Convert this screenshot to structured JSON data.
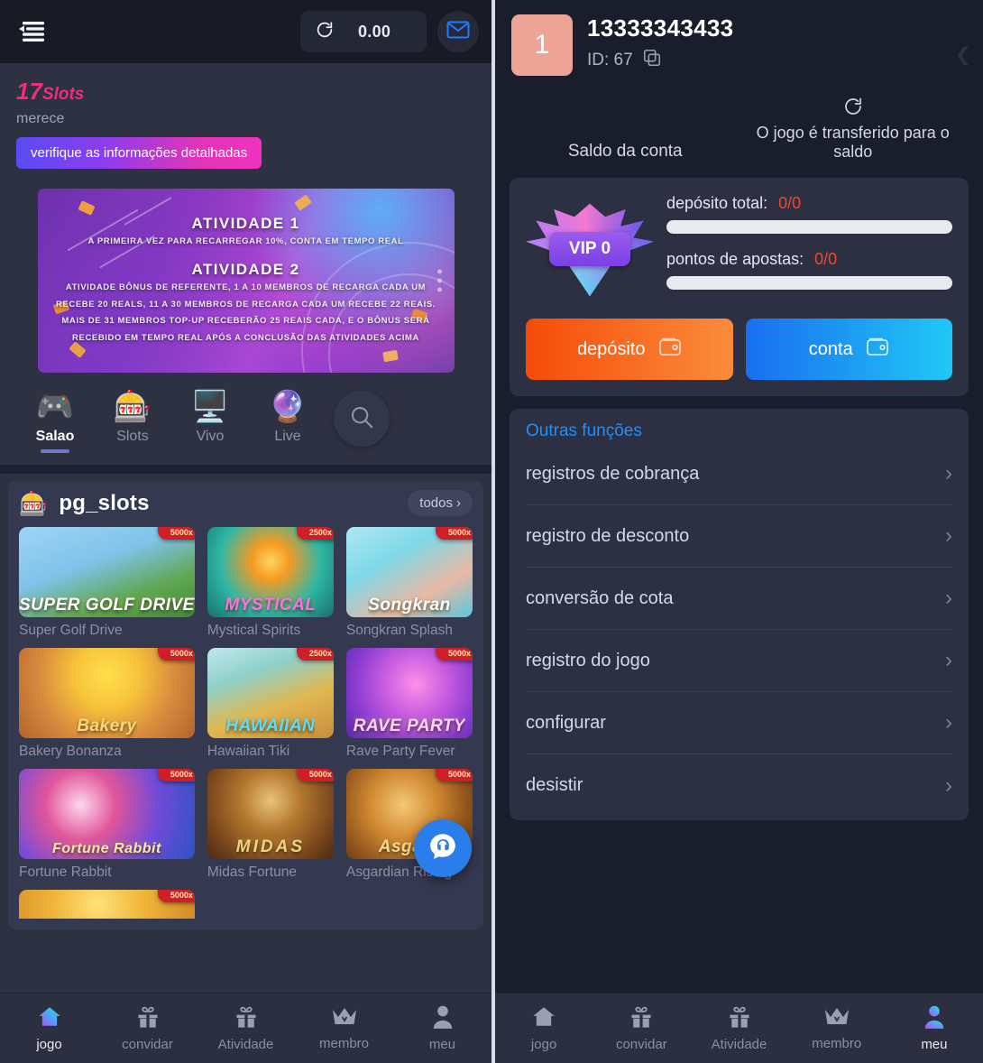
{
  "left": {
    "topbar": {
      "menu_icon": "hamburger-menu-icon",
      "refresh_icon": "refresh-icon",
      "balance": "0.00",
      "mail_icon": "envelope-icon"
    },
    "promo": {
      "brand_number": "17",
      "brand_word": "Slots",
      "subtitle": "merece",
      "button": "verifique as informações detalhadas"
    },
    "banner": {
      "heading1": "ATIVIDADE 1",
      "line1": "A PRIMEIRA VEZ PARA RECARREGAR 10%, CONTA EM TEMPO REAL",
      "heading2": "ATIVIDADE 2",
      "line2": "ATIVIDADE BÔNUS DE REFERENTE, 1 A 10 MEMBROS DE RECARGA CADA UM",
      "line3": "RECEBE 20 REALS, 11 A 30 MEMBROS DE RECARGA CADA UM RECEBE 22 REAIS.",
      "line4": "MAIS DE 31 MEMBROS TOP-UP RECEBERÃO 25 REAIS CADA, E O BÔNUS SERÁ",
      "line5": "RECEBIDO EM TEMPO REAL APÓS A CONCLUSÃO DAS ATIVIDADES ACIMA"
    },
    "categories": [
      {
        "label": "Salao",
        "icon": "gamepad-icon",
        "glyph": "🎮",
        "active": true
      },
      {
        "label": "Slots",
        "icon": "slot-machine-icon",
        "glyph": "🎰",
        "active": false
      },
      {
        "label": "Vivo",
        "icon": "live-monitor-icon",
        "glyph": "🖥️",
        "active": false
      },
      {
        "label": "Live",
        "icon": "globe-icon",
        "glyph": "🔮",
        "active": false
      }
    ],
    "search_icon": "search-icon",
    "games_section": {
      "icon": "slot-machine-icon",
      "icon_glyph": "🎰",
      "title": "pg_slots",
      "all_label": "todos",
      "games": [
        {
          "name": "Super Golf Drive",
          "multiplier": "5000x",
          "logo": "SUPER GOLF DRIVE"
        },
        {
          "name": "Mystical Spirits",
          "multiplier": "2500x",
          "logo": "MYSTICAL"
        },
        {
          "name": "Songkran Splash",
          "multiplier": "5000x",
          "logo": "Songkran"
        },
        {
          "name": "Bakery Bonanza",
          "multiplier": "5000x",
          "logo": "Bakery"
        },
        {
          "name": "Hawaiian Tiki",
          "multiplier": "2500x",
          "logo": "HAWAIIAN"
        },
        {
          "name": "Rave Party Fever",
          "multiplier": "5000x",
          "logo": "RAVE PARTY"
        },
        {
          "name": "Fortune Rabbit",
          "multiplier": "5000x",
          "logo": "Fortune Rabbit"
        },
        {
          "name": "Midas Fortune",
          "multiplier": "5000x",
          "logo": "MIDAS"
        },
        {
          "name": "Asgardian Rising",
          "multiplier": "5000x",
          "logo": "Asgard"
        }
      ],
      "partial_tile_multiplier": "5000x"
    },
    "support_icon": "headset-support-icon",
    "bottomnav": [
      {
        "label": "jogo",
        "icon": "home-icon",
        "glyph": "⌂",
        "active": true
      },
      {
        "label": "convidar",
        "icon": "gift-icon",
        "glyph": "🎁",
        "active": false
      },
      {
        "label": "Atividade",
        "icon": "gift-icon",
        "glyph": "🎁",
        "active": false
      },
      {
        "label": "membro",
        "icon": "crown-icon",
        "glyph": "♛",
        "active": false
      },
      {
        "label": "meu",
        "icon": "person-icon",
        "glyph": "👤",
        "active": false
      }
    ]
  },
  "right": {
    "avatar_text": "1",
    "username": "13333343433",
    "id_label": "ID: 67",
    "copy_icon": "copy-icon",
    "collapse_icon": "chevron-left-icon",
    "balance_label": "Saldo da conta",
    "transfer_icon": "refresh-icon",
    "transfer_label": "O jogo é transferido para o saldo",
    "vip": {
      "badge_label": "VIP 0",
      "deposit_label": "depósito total:",
      "deposit_value": "0/0",
      "deposit_progress": 0,
      "points_label": "pontos de apostas:",
      "points_value": "0/0",
      "points_progress": 0,
      "deposit_button": "depósito",
      "account_button": "conta",
      "wallet_icon": "wallet-icon"
    },
    "functions": {
      "title": "Outras funções",
      "items": [
        {
          "label": "registros de cobrança"
        },
        {
          "label": "registro de desconto"
        },
        {
          "label": "conversão de cota"
        },
        {
          "label": "registro do jogo"
        },
        {
          "label": "configurar"
        },
        {
          "label": "desistir"
        }
      ]
    },
    "bottomnav": [
      {
        "label": "jogo",
        "icon": "home-icon",
        "glyph": "⌂",
        "active": false
      },
      {
        "label": "convidar",
        "icon": "gift-icon",
        "glyph": "🎁",
        "active": false
      },
      {
        "label": "Atividade",
        "icon": "gift-icon",
        "glyph": "🎁",
        "active": false
      },
      {
        "label": "membro",
        "icon": "crown-icon",
        "glyph": "♛",
        "active": false
      },
      {
        "label": "meu",
        "icon": "person-icon",
        "glyph": "👤",
        "active": true
      }
    ]
  },
  "colors": {
    "left_bg": "#2e3142",
    "right_bg": "#1a1d2b",
    "accent_pink": "#f02d7d",
    "accent_blue": "#1e90ff",
    "warn_red": "#ef4a2c",
    "deposit_orange": "#f54c08",
    "account_blue": "#1a6ff0"
  }
}
